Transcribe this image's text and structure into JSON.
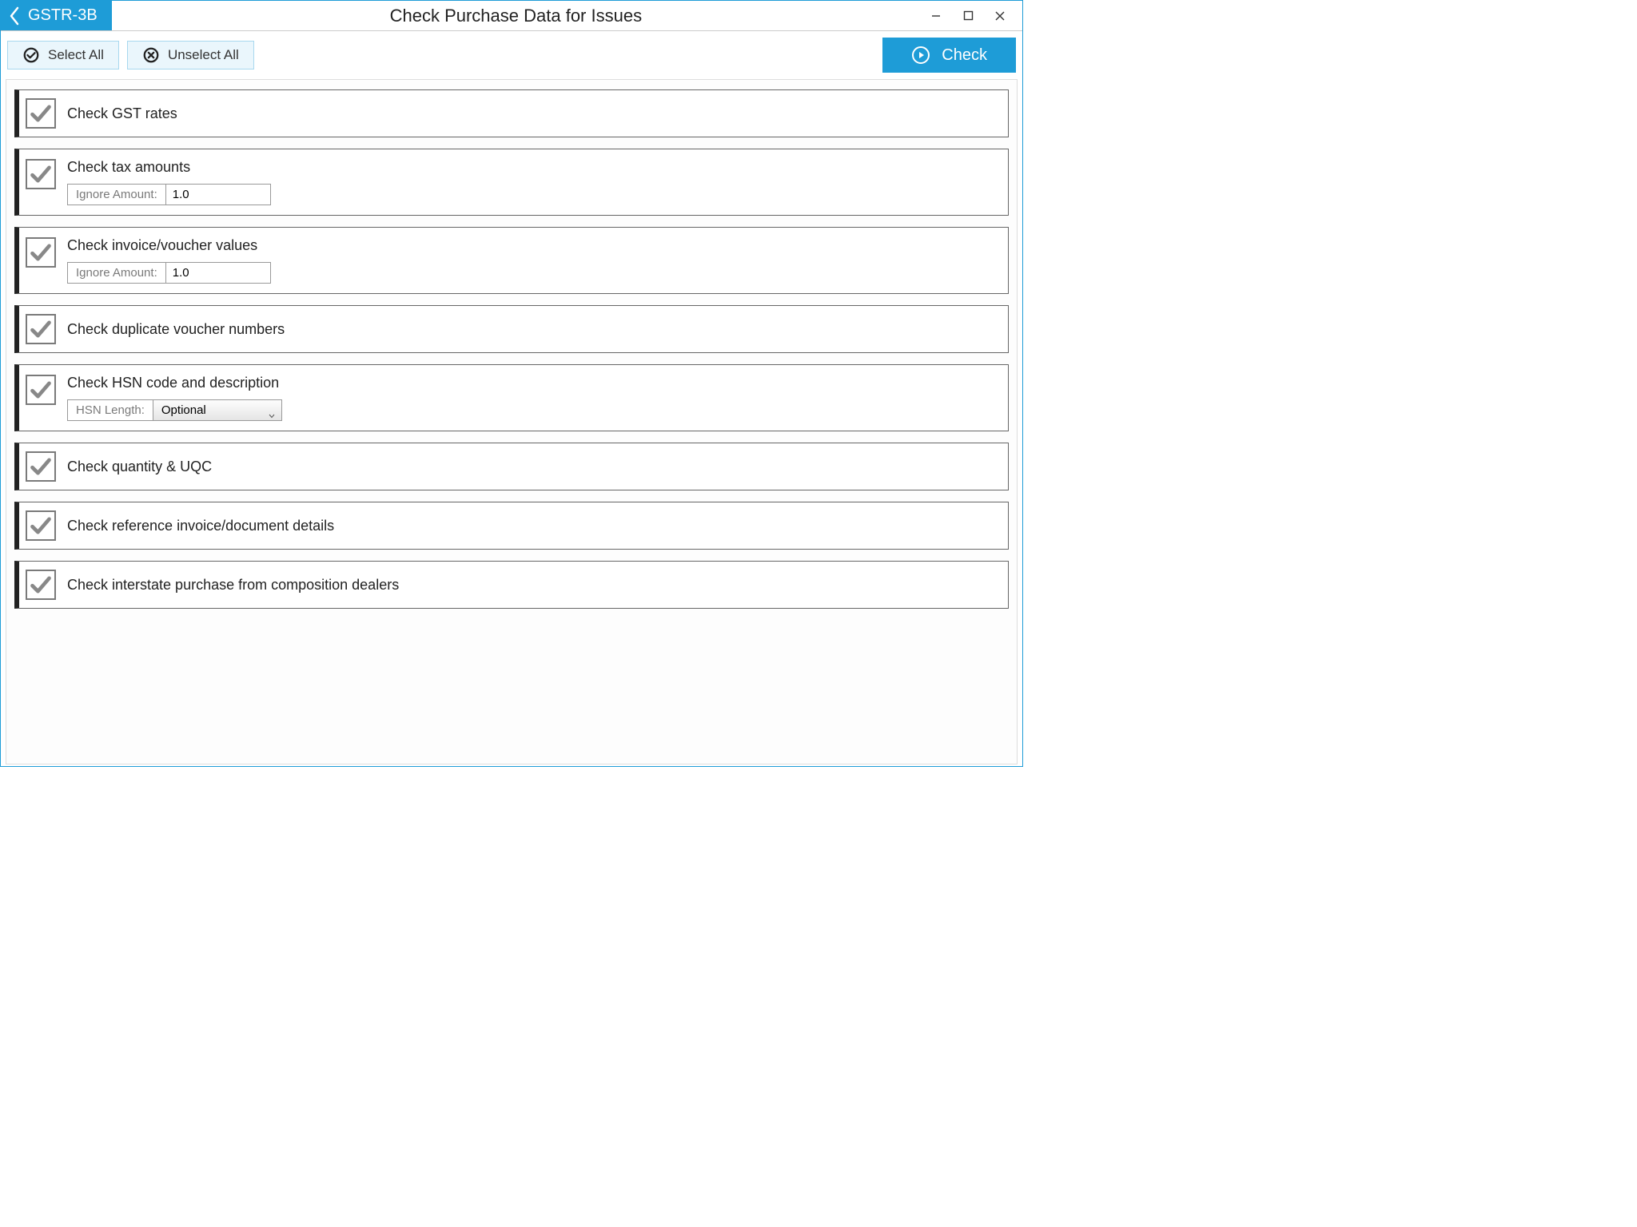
{
  "header": {
    "back_label": "GSTR-3B",
    "title": "Check Purchase Data for Issues"
  },
  "toolbar": {
    "select_all": "Select All",
    "unselect_all": "Unselect All",
    "check": "Check"
  },
  "items": [
    {
      "title": "Check GST rates"
    },
    {
      "title": "Check tax amounts",
      "sub_label": "Ignore Amount:",
      "sub_value": "1.0",
      "sub_type": "text"
    },
    {
      "title": "Check invoice/voucher values",
      "sub_label": "Ignore Amount:",
      "sub_value": "1.0",
      "sub_type": "text"
    },
    {
      "title": "Check duplicate voucher numbers"
    },
    {
      "title": "Check HSN code and description",
      "sub_label": "HSN Length:",
      "sub_value": "Optional",
      "sub_type": "select"
    },
    {
      "title": "Check quantity & UQC"
    },
    {
      "title": "Check reference invoice/document details"
    },
    {
      "title": "Check interstate purchase from composition dealers"
    }
  ]
}
